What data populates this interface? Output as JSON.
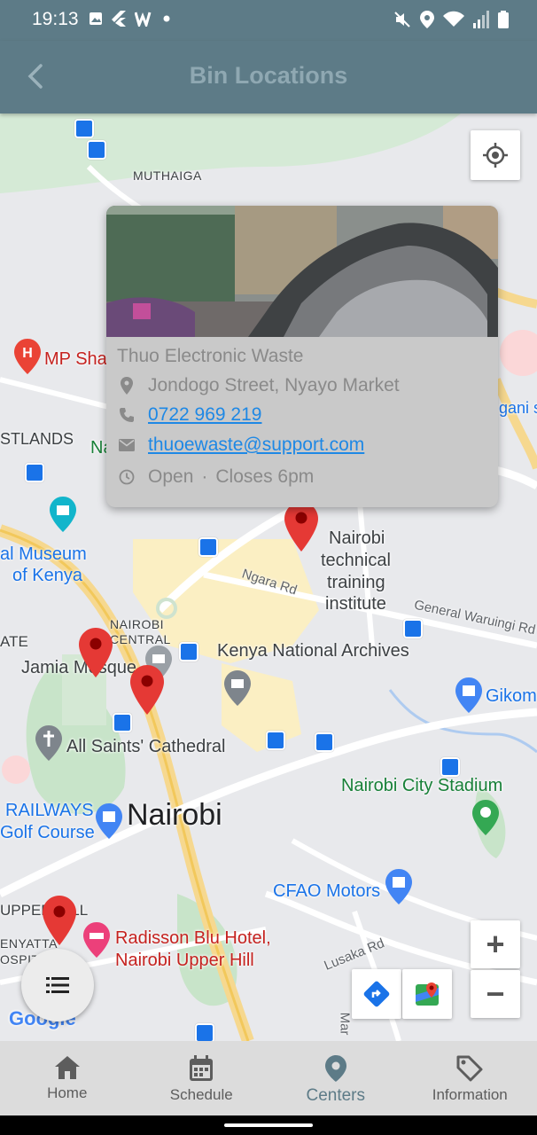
{
  "status_bar": {
    "time": "19:13"
  },
  "app_bar": {
    "title": "Bin Locations"
  },
  "map": {
    "labels": {
      "muthaiga": "MUTHAIGA",
      "mp_shah": "MP Sha",
      "westlands": "STLANDS",
      "na": "Na",
      "museum": "al Museum",
      "museum2": "of Kenya",
      "nairobi_tech": "Nairobi",
      "nairobi_tech2": "technical",
      "nairobi_tech3": "training",
      "nairobi_tech4": "institute",
      "ngara_rd": "Ngara Rd",
      "general_waruingi": "General Waruingi Rd",
      "gikomba": "Gikom",
      "ngani": "gani s",
      "nairobi_central": "NAIROBI",
      "nairobi_central2": "CENTRAL",
      "ate": "ATE",
      "jamia": "Jamia Mosque",
      "kenya_archives": "Kenya National Archives",
      "all_saints": "All Saints' Cathedral",
      "city_stadium": "Nairobi City Stadium",
      "railways": "RAILWAYS",
      "golf": "Golf Course",
      "nairobi": "Nairobi",
      "cfao": "CFAO Motors",
      "upper_hill": "UPPER HILL",
      "kenyatta": "ENYATTA",
      "hospital": "OSPIT",
      "radisson": "Radisson Blu Hotel,",
      "radisson2": "Nairobi Upper Hill",
      "lusaka": "Lusaka Rd",
      "mar": "Mar",
      "google": "Google"
    },
    "popup": {
      "name": "Thuo Electronic Waste",
      "address": "Jondogo Street, Nyayo Market",
      "phone": "0722 969 219",
      "email": "thuoewaste@support.com",
      "hours_status": "Open",
      "hours_separator": "·",
      "hours_close": "Closes 6pm"
    },
    "zoom_in": "+",
    "zoom_out": "−",
    "colors": {
      "pin": "#e53935",
      "accent": "#5d7b87",
      "link": "#1e88e5"
    }
  },
  "bottom_nav": {
    "items": [
      {
        "label": "Home",
        "icon": "home-icon"
      },
      {
        "label": "Schedule",
        "icon": "calendar-icon"
      },
      {
        "label": "Centers",
        "icon": "location-pin-icon",
        "active": true
      },
      {
        "label": "Information",
        "icon": "tag-icon"
      }
    ]
  }
}
